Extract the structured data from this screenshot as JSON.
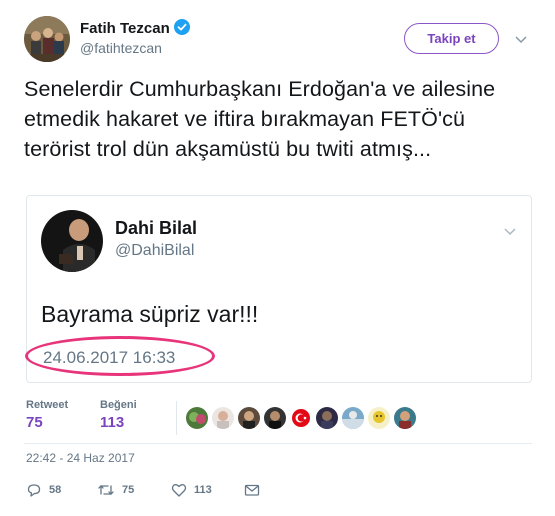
{
  "author": {
    "name": "Fatih Tezcan",
    "handle": "@fatihtezcan",
    "verified_icon": "verified-badge-icon"
  },
  "follow_button": {
    "label": "Takip et"
  },
  "tweet": {
    "text": "Senelerdir Cumhurbaşkanı Erdoğan'a ve ailesine etmedik hakaret ve iftira bırakmayan FETÖ'cü terörist trol dün akşamüstü bu twiti atmış..."
  },
  "quoted": {
    "name": "Dahi Bilal",
    "handle": "@DahiBilal",
    "text": "Bayrama süpriz var!!!",
    "time": "24.06.2017 16:33",
    "highlight_color": "#e8347a"
  },
  "stats": {
    "retweets_label": "Retweet",
    "retweets_value": "75",
    "likes_label": "Beğeni",
    "likes_value": "113",
    "accent": "#7b44bf"
  },
  "timestamp": "22:42 - 24 Haz 2017",
  "actions": {
    "reply_count": "58",
    "retweet_count": "75",
    "like_count": "113"
  },
  "colors": {
    "text": "#14171a",
    "secondary": "#657786",
    "border": "#e1e8ed",
    "brand_purple": "#7b44bf"
  }
}
